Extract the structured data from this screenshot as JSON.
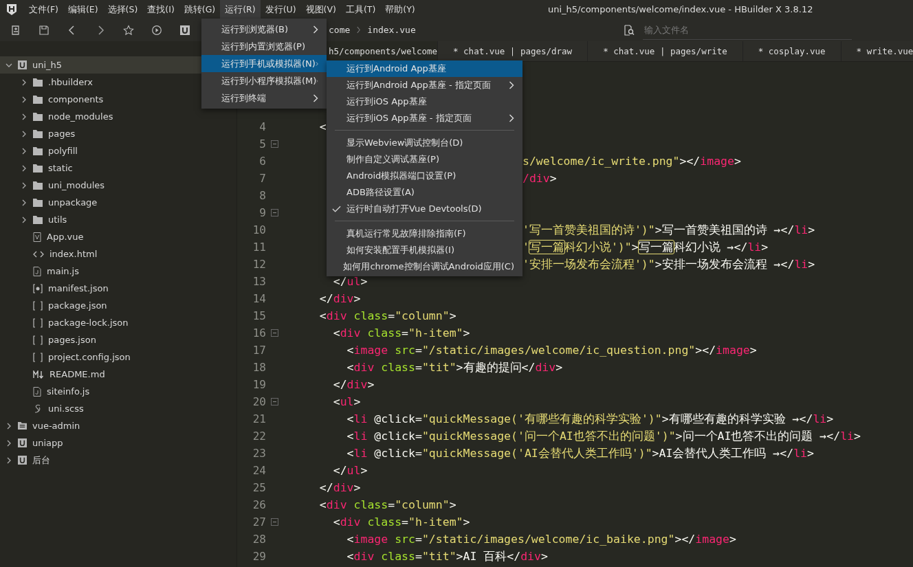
{
  "menubar": [
    {
      "label": "文件(F)",
      "selected": false
    },
    {
      "label": "编辑(E)",
      "selected": false
    },
    {
      "label": "选择(S)",
      "selected": false
    },
    {
      "label": "查找(I)",
      "selected": false
    },
    {
      "label": "跳转(G)",
      "selected": false
    },
    {
      "label": "运行(R)",
      "selected": true
    },
    {
      "label": "发行(U)",
      "selected": false
    },
    {
      "label": "视图(V)",
      "selected": false
    },
    {
      "label": "工具(T)",
      "selected": false
    },
    {
      "label": "帮助(Y)",
      "selected": false
    }
  ],
  "window": {
    "title": "uni_h5/components/welcome/index.vue - HBuilder X 3.8.12"
  },
  "breadcrumb": [
    "come",
    "index.vue"
  ],
  "search": {
    "placeholder": "输入文件名"
  },
  "tabs": [
    {
      "label": "h5/components/welcome",
      "selected": true
    },
    {
      "label": "* chat.vue | pages/draw",
      "selected": false
    },
    {
      "label": "* chat.vue | pages/write",
      "selected": false
    },
    {
      "label": "* cosplay.vue",
      "selected": false
    },
    {
      "label": "* write.vue",
      "selected": false
    }
  ],
  "tree": [
    {
      "label": "uni_h5",
      "kind": "project",
      "expanded": true,
      "selected": true,
      "children": [
        {
          "label": ".hbuilderx",
          "kind": "folder",
          "expanded": false,
          "selected": false
        },
        {
          "label": "components",
          "kind": "folder",
          "expanded": false,
          "selected": false
        },
        {
          "label": "node_modules",
          "kind": "folder",
          "expanded": false,
          "selected": false
        },
        {
          "label": "pages",
          "kind": "folder",
          "expanded": false,
          "selected": false
        },
        {
          "label": "polyfill",
          "kind": "folder",
          "expanded": false,
          "selected": false
        },
        {
          "label": "static",
          "kind": "folder",
          "expanded": false,
          "selected": false
        },
        {
          "label": "uni_modules",
          "kind": "folder",
          "expanded": false,
          "selected": false
        },
        {
          "label": "unpackage",
          "kind": "folder",
          "expanded": false,
          "selected": false
        },
        {
          "label": "utils",
          "kind": "folder",
          "expanded": false,
          "selected": false
        },
        {
          "label": "App.vue",
          "kind": "vue",
          "selected": false
        },
        {
          "label": "index.html",
          "kind": "html",
          "selected": false
        },
        {
          "label": "main.js",
          "kind": "js",
          "selected": false
        },
        {
          "label": "manifest.json",
          "kind": "manifest",
          "selected": false
        },
        {
          "label": "package.json",
          "kind": "json",
          "selected": false
        },
        {
          "label": "package-lock.json",
          "kind": "json",
          "selected": false
        },
        {
          "label": "pages.json",
          "kind": "json",
          "selected": false
        },
        {
          "label": "project.config.json",
          "kind": "json",
          "selected": false
        },
        {
          "label": "README.md",
          "kind": "md",
          "selected": false
        },
        {
          "label": "siteinfo.js",
          "kind": "js",
          "selected": false
        },
        {
          "label": "uni.scss",
          "kind": "scss",
          "selected": false
        }
      ]
    },
    {
      "label": "vue-admin",
      "kind": "web",
      "expanded": false,
      "selected": false
    },
    {
      "label": "uniapp",
      "kind": "project",
      "expanded": false,
      "selected": false
    },
    {
      "label": "后台",
      "kind": "project",
      "expanded": false,
      "selected": false
    }
  ],
  "code_lines": [
    {
      "number": "4",
      "fold": false,
      "tokens": [
        {
          "kind": "punct",
          "text": "  <"
        }
      ]
    },
    {
      "number": "5",
      "fold": true
    },
    {
      "number": "6",
      "fold": false,
      "covered": true,
      "tokens": [
        {
          "kind": "string",
          "text": "s/welcome/ic_write.png\""
        },
        {
          "kind": "punct",
          "text": "></"
        },
        {
          "kind": "tag",
          "text": "image"
        },
        {
          "kind": "punct",
          "text": ">"
        }
      ]
    },
    {
      "number": "7",
      "fold": false,
      "covered": true,
      "tokens": [
        {
          "kind": "tag",
          "text": "/div"
        },
        {
          "kind": "punct",
          "text": ">"
        }
      ]
    },
    {
      "number": "8",
      "fold": false
    },
    {
      "number": "9",
      "fold": true
    },
    {
      "number": "10",
      "fold": false,
      "covered": true,
      "tokens": [
        {
          "kind": "string",
          "text": "'写一首赞美祖国的诗')\""
        },
        {
          "kind": "punct",
          "text": ">写一首赞美祖国的诗 →</"
        },
        {
          "kind": "tag",
          "text": "li"
        },
        {
          "kind": "punct",
          "text": ">"
        }
      ]
    },
    {
      "number": "11",
      "fold": false,
      "covered": true,
      "tokens": [
        {
          "kind": "string",
          "text": "'"
        },
        {
          "kind": "string",
          "text": "写一篇",
          "match": true
        },
        {
          "kind": "string",
          "text": "科幻小说')\""
        },
        {
          "kind": "punct",
          "text": ">"
        },
        {
          "kind": "punct",
          "text": "写一篇",
          "match": true
        },
        {
          "kind": "punct",
          "text": "科幻小说 →</"
        },
        {
          "kind": "tag",
          "text": "li"
        },
        {
          "kind": "punct",
          "text": ">"
        }
      ]
    },
    {
      "number": "12",
      "fold": false,
      "covered": true,
      "tokens": [
        {
          "kind": "string",
          "text": "'安排一场发布会流程')\""
        },
        {
          "kind": "punct",
          "text": ">安排一场发布会流程 →</"
        },
        {
          "kind": "tag",
          "text": "li"
        },
        {
          "kind": "punct",
          "text": ">"
        }
      ]
    },
    {
      "number": "13",
      "fold": false,
      "tokens": [
        {
          "kind": "punct",
          "text": "    </"
        },
        {
          "kind": "tag",
          "text": "ul"
        },
        {
          "kind": "punct",
          "text": ">"
        }
      ]
    },
    {
      "number": "14",
      "fold": false,
      "tokens": [
        {
          "kind": "punct",
          "text": "  </"
        },
        {
          "kind": "tag",
          "text": "div"
        },
        {
          "kind": "punct",
          "text": ">"
        }
      ]
    },
    {
      "number": "15",
      "fold": false,
      "tokens": [
        {
          "kind": "punct",
          "text": "  <"
        },
        {
          "kind": "tag",
          "text": "div"
        },
        {
          "kind": "attr",
          "text": " class"
        },
        {
          "kind": "punct",
          "text": "="
        },
        {
          "kind": "string",
          "text": "\"column\""
        },
        {
          "kind": "punct",
          "text": ">"
        }
      ]
    },
    {
      "number": "16",
      "fold": true,
      "tokens": [
        {
          "kind": "punct",
          "text": "    <"
        },
        {
          "kind": "tag",
          "text": "div"
        },
        {
          "kind": "attr",
          "text": " class"
        },
        {
          "kind": "punct",
          "text": "="
        },
        {
          "kind": "string",
          "text": "\"h-item\""
        },
        {
          "kind": "punct",
          "text": ">"
        }
      ]
    },
    {
      "number": "17",
      "fold": false,
      "tokens": [
        {
          "kind": "punct",
          "text": "      <"
        },
        {
          "kind": "tag",
          "text": "image"
        },
        {
          "kind": "attr",
          "text": " src"
        },
        {
          "kind": "punct",
          "text": "="
        },
        {
          "kind": "string",
          "text": "\"/static/images/welcome/ic_question.png\""
        },
        {
          "kind": "punct",
          "text": "></"
        },
        {
          "kind": "tag",
          "text": "image"
        },
        {
          "kind": "punct",
          "text": ">"
        }
      ]
    },
    {
      "number": "18",
      "fold": false,
      "tokens": [
        {
          "kind": "punct",
          "text": "      <"
        },
        {
          "kind": "tag",
          "text": "div"
        },
        {
          "kind": "attr",
          "text": " class"
        },
        {
          "kind": "punct",
          "text": "="
        },
        {
          "kind": "string",
          "text": "\"tit\""
        },
        {
          "kind": "punct",
          "text": ">有趣的提问</"
        },
        {
          "kind": "tag",
          "text": "div"
        },
        {
          "kind": "punct",
          "text": ">"
        }
      ]
    },
    {
      "number": "19",
      "fold": false,
      "tokens": [
        {
          "kind": "punct",
          "text": "    </"
        },
        {
          "kind": "tag",
          "text": "div"
        },
        {
          "kind": "punct",
          "text": ">"
        }
      ]
    },
    {
      "number": "20",
      "fold": true,
      "tokens": [
        {
          "kind": "punct",
          "text": "    <"
        },
        {
          "kind": "tag",
          "text": "ul"
        },
        {
          "kind": "punct",
          "text": ">"
        }
      ]
    },
    {
      "number": "21",
      "fold": false,
      "tokens": [
        {
          "kind": "punct",
          "text": "      <"
        },
        {
          "kind": "tag",
          "text": "li"
        },
        {
          "kind": "punct",
          "text": " @click="
        },
        {
          "kind": "string",
          "text": "\"quickMessage('有哪些有趣的科学实验')\""
        },
        {
          "kind": "punct",
          "text": ">有哪些有趣的科学实验 →</"
        },
        {
          "kind": "tag",
          "text": "li"
        },
        {
          "kind": "punct",
          "text": ">"
        }
      ]
    },
    {
      "number": "22",
      "fold": false,
      "tokens": [
        {
          "kind": "punct",
          "text": "      <"
        },
        {
          "kind": "tag",
          "text": "li"
        },
        {
          "kind": "punct",
          "text": " @click="
        },
        {
          "kind": "string",
          "text": "\"quickMessage('问一个AI也答不出的问题')\""
        },
        {
          "kind": "punct",
          "text": ">问一个AI也答不出的问题 →</"
        },
        {
          "kind": "tag",
          "text": "li"
        },
        {
          "kind": "punct",
          "text": ">"
        }
      ]
    },
    {
      "number": "23",
      "fold": false,
      "tokens": [
        {
          "kind": "punct",
          "text": "      <"
        },
        {
          "kind": "tag",
          "text": "li"
        },
        {
          "kind": "punct",
          "text": " @click="
        },
        {
          "kind": "string",
          "text": "\"quickMessage('AI会替代人类工作吗')\""
        },
        {
          "kind": "punct",
          "text": ">AI会替代人类工作吗 →</"
        },
        {
          "kind": "tag",
          "text": "li"
        },
        {
          "kind": "punct",
          "text": ">"
        }
      ]
    },
    {
      "number": "24",
      "fold": false,
      "tokens": [
        {
          "kind": "punct",
          "text": "    </"
        },
        {
          "kind": "tag",
          "text": "ul"
        },
        {
          "kind": "punct",
          "text": ">"
        }
      ]
    },
    {
      "number": "25",
      "fold": false,
      "tokens": [
        {
          "kind": "punct",
          "text": "  </"
        },
        {
          "kind": "tag",
          "text": "div"
        },
        {
          "kind": "punct",
          "text": ">"
        }
      ]
    },
    {
      "number": "26",
      "fold": false,
      "tokens": [
        {
          "kind": "punct",
          "text": "  <"
        },
        {
          "kind": "tag",
          "text": "div"
        },
        {
          "kind": "attr",
          "text": " class"
        },
        {
          "kind": "punct",
          "text": "="
        },
        {
          "kind": "string",
          "text": "\"column\""
        },
        {
          "kind": "punct",
          "text": ">"
        }
      ]
    },
    {
      "number": "27",
      "fold": true,
      "tokens": [
        {
          "kind": "punct",
          "text": "    <"
        },
        {
          "kind": "tag",
          "text": "div"
        },
        {
          "kind": "attr",
          "text": " class"
        },
        {
          "kind": "punct",
          "text": "="
        },
        {
          "kind": "string",
          "text": "\"h-item\""
        },
        {
          "kind": "punct",
          "text": ">"
        }
      ]
    },
    {
      "number": "28",
      "fold": false,
      "tokens": [
        {
          "kind": "punct",
          "text": "      <"
        },
        {
          "kind": "tag",
          "text": "image"
        },
        {
          "kind": "attr",
          "text": " src"
        },
        {
          "kind": "punct",
          "text": "="
        },
        {
          "kind": "string",
          "text": "\"/static/images/welcome/ic_baike.png\""
        },
        {
          "kind": "punct",
          "text": "></"
        },
        {
          "kind": "tag",
          "text": "image"
        },
        {
          "kind": "punct",
          "text": ">"
        }
      ]
    },
    {
      "number": "29",
      "fold": false,
      "tokens": [
        {
          "kind": "punct",
          "text": "      <"
        },
        {
          "kind": "tag",
          "text": "div"
        },
        {
          "kind": "attr",
          "text": " class"
        },
        {
          "kind": "punct",
          "text": "="
        },
        {
          "kind": "string",
          "text": "\"tit\""
        },
        {
          "kind": "punct",
          "text": ">AI 百科</"
        },
        {
          "kind": "tag",
          "text": "div"
        },
        {
          "kind": "punct",
          "text": ">"
        }
      ]
    }
  ],
  "run_menu": [
    {
      "label": "运行到浏览器(B)",
      "submenu": true,
      "selected": false
    },
    {
      "label": "运行到内置浏览器(P)",
      "submenu": false,
      "selected": false
    },
    {
      "label": "运行到手机或模拟器(N)",
      "submenu": true,
      "selected": true
    },
    {
      "label": "运行到小程序模拟器(M)",
      "submenu": true,
      "selected": false
    },
    {
      "label": "运行到终端",
      "submenu": true,
      "selected": false
    }
  ],
  "device_menu": [
    {
      "kind": "item",
      "label": "运行到Android App基座",
      "submenu": false,
      "checked": false,
      "selected": true
    },
    {
      "kind": "item",
      "label": "运行到Android App基座 - 指定页面",
      "submenu": true,
      "checked": false,
      "selected": false
    },
    {
      "kind": "item",
      "label": "运行到iOS App基座",
      "submenu": false,
      "checked": false,
      "selected": false
    },
    {
      "kind": "item",
      "label": "运行到iOS App基座 - 指定页面",
      "submenu": true,
      "checked": false,
      "selected": false
    },
    {
      "kind": "separator"
    },
    {
      "kind": "item",
      "label": "显示Webview调试控制台(D)",
      "submenu": false,
      "checked": false,
      "selected": false
    },
    {
      "kind": "item",
      "label": "制作自定义调试基座(P)",
      "submenu": false,
      "checked": false,
      "selected": false
    },
    {
      "kind": "item",
      "label": "Android模拟器端口设置(P)",
      "submenu": false,
      "checked": false,
      "selected": false
    },
    {
      "kind": "item",
      "label": "ADB路径设置(A)",
      "submenu": false,
      "checked": false,
      "selected": false
    },
    {
      "kind": "item",
      "label": "运行时自动打开Vue Devtools(D)",
      "submenu": false,
      "checked": true,
      "selected": false
    },
    {
      "kind": "separator"
    },
    {
      "kind": "item",
      "label": "真机运行常见故障排除指南(F)",
      "submenu": false,
      "checked": false,
      "selected": false
    },
    {
      "kind": "item",
      "label": "如何安装配置手机模拟器(I)",
      "submenu": false,
      "checked": false,
      "selected": false
    },
    {
      "kind": "item",
      "label": "如何用chrome控制台调试Android应用(C)",
      "submenu": false,
      "checked": false,
      "selected": false
    }
  ]
}
